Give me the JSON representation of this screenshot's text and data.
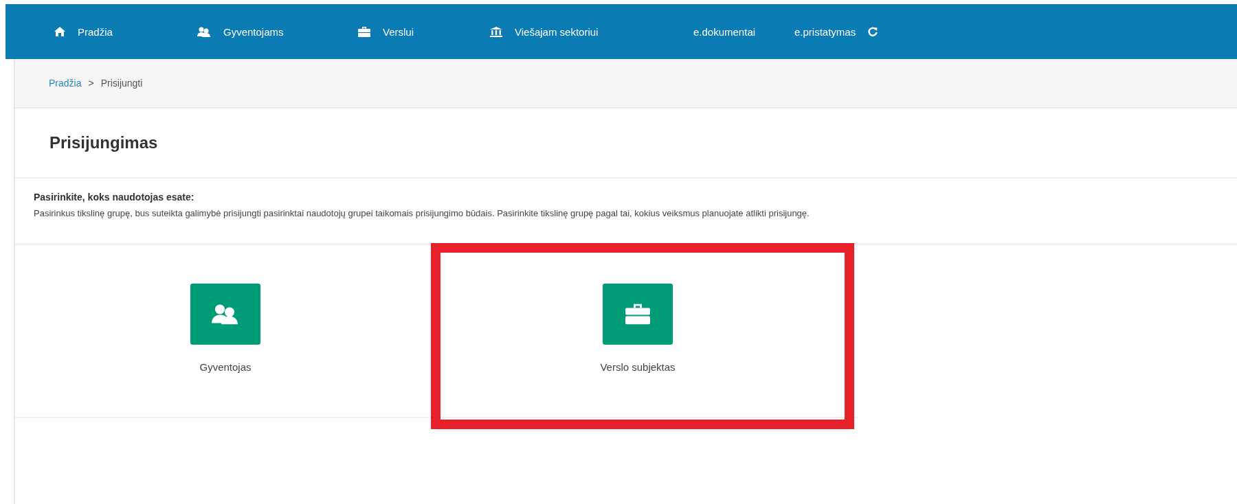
{
  "nav": {
    "items": [
      {
        "label": "Pradžia"
      },
      {
        "label": "Gyventojams"
      },
      {
        "label": "Verslui"
      },
      {
        "label": "Viešajam sektoriui"
      },
      {
        "label": "e.dokumentai"
      },
      {
        "label": "e.pristatymas"
      }
    ]
  },
  "breadcrumb": {
    "items": [
      "Pradžia",
      "Prisijungti"
    ],
    "separator": ">"
  },
  "page_title": "Prisijungimas",
  "intro": {
    "heading": "Pasirinkite, koks naudotojas esate:",
    "text": "Pasirinkus tikslinę grupę, bus suteikta galimybė prisijungti pasirinktai naudotojų grupei taikomais prisijungimo būdais. Pasirinkite tikslinę grupę pagal tai, kokius veiksmus planuojate atlikti prisijungę."
  },
  "options": [
    {
      "label": "Gyventojas",
      "highlighted": false
    },
    {
      "label": "Verslo subjektas",
      "highlighted": true
    }
  ]
}
